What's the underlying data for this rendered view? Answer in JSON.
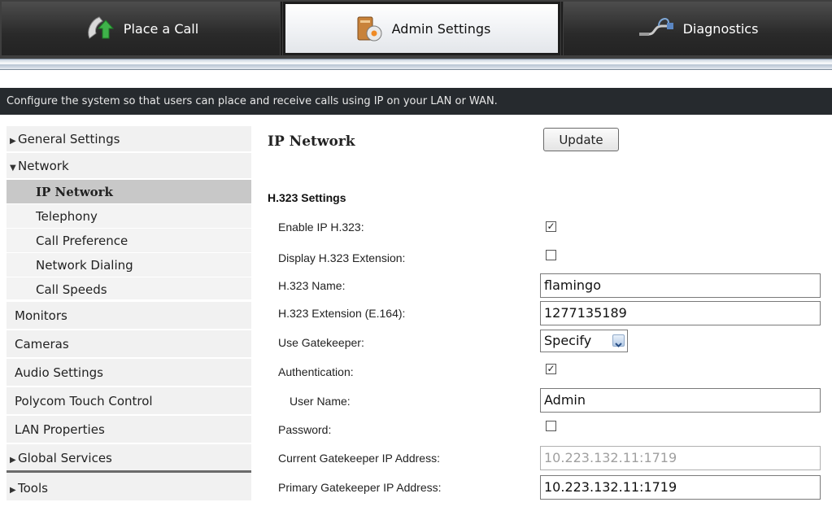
{
  "tabs": [
    {
      "label": "Place a Call",
      "icon": "phone-icon"
    },
    {
      "label": "Admin Settings",
      "icon": "admin-icon"
    },
    {
      "label": "Diagnostics",
      "icon": "diagnostics-icon"
    }
  ],
  "banner": "Configure the system so that users can place and receive calls using IP on your LAN or WAN.",
  "sidebar": {
    "general_settings": "General Settings",
    "network": "Network",
    "network_items": [
      "IP Network",
      "Telephony",
      "Call Preference",
      "Network Dialing",
      "Call Speeds"
    ],
    "monitors": "Monitors",
    "cameras": "Cameras",
    "audio_settings": "Audio Settings",
    "polycom_touch_control": "Polycom Touch Control",
    "lan_properties": "LAN Properties",
    "global_services": "Global Services",
    "tools": "Tools"
  },
  "main": {
    "title": "IP Network",
    "update_label": "Update",
    "section_title": "H.323 Settings",
    "fields": {
      "enable_ip_h323": {
        "label": "Enable IP H.323:",
        "checked": true
      },
      "display_h323_extension": {
        "label": "Display H.323 Extension:",
        "checked": false
      },
      "h323_name": {
        "label": "H.323 Name:",
        "value": "flamingo"
      },
      "h323_extension": {
        "label": "H.323 Extension (E.164):",
        "value": "1277135189"
      },
      "use_gatekeeper": {
        "label": "Use Gatekeeper:",
        "value": "Specify"
      },
      "authentication": {
        "label": "Authentication:",
        "checked": true
      },
      "user_name": {
        "label": "User Name:",
        "value": "Admin"
      },
      "password": {
        "label": "Password:",
        "checked": false
      },
      "current_gatekeeper": {
        "label": "Current Gatekeeper IP Address:",
        "value": "10.223.132.11:1719"
      },
      "primary_gatekeeper": {
        "label": "Primary Gatekeeper IP Address:",
        "value": "10.223.132.11:1719"
      }
    },
    "check_mark": "✓"
  }
}
